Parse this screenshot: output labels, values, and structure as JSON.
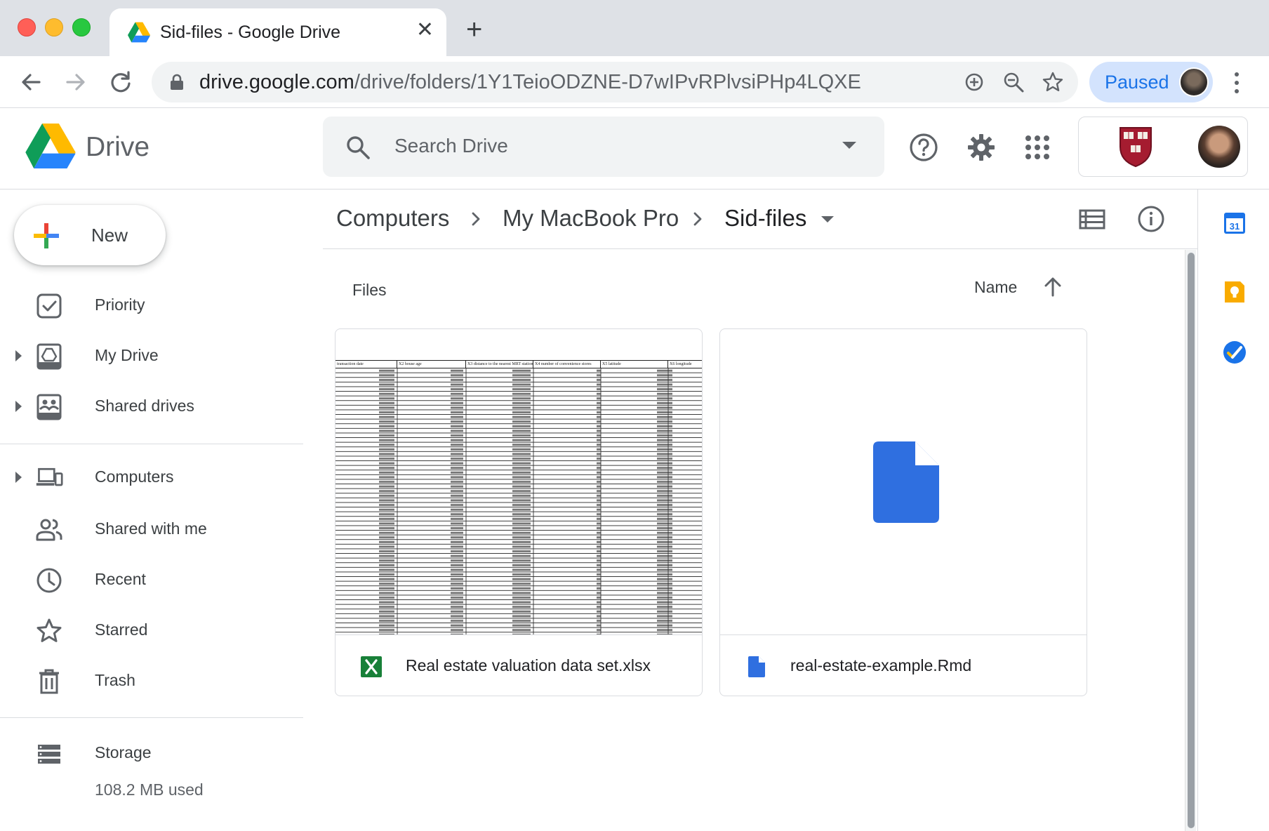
{
  "browser": {
    "tab_title": "Sid-files - Google Drive",
    "tab_close": "✕",
    "new_tab": "+",
    "url_host": "drive.google.com",
    "url_path": "/drive/folders/1Y1TeioODZNE-D7wIPvRPlvsiPHp4LQXE",
    "profile_status": "Paused"
  },
  "header": {
    "app_name": "Drive",
    "search_placeholder": "Search Drive"
  },
  "sidebar": {
    "new_label": "New",
    "items": [
      {
        "label": "Priority",
        "icon": "priority-icon"
      },
      {
        "label": "My Drive",
        "icon": "my-drive-icon"
      },
      {
        "label": "Shared drives",
        "icon": "shared-drives-icon"
      },
      {
        "label": "Computers",
        "icon": "computers-icon"
      },
      {
        "label": "Shared with me",
        "icon": "shared-with-me-icon"
      },
      {
        "label": "Recent",
        "icon": "recent-icon"
      },
      {
        "label": "Starred",
        "icon": "star-icon"
      },
      {
        "label": "Trash",
        "icon": "trash-icon"
      },
      {
        "label": "Storage",
        "icon": "storage-icon"
      }
    ],
    "storage_used": "108.2 MB used"
  },
  "main": {
    "breadcrumb": [
      "Computers",
      "My MacBook Pro",
      "Sid-files"
    ],
    "section_heading": "Files",
    "sort_label": "Name",
    "files": [
      {
        "name": "Real estate valuation data set.xlsx",
        "type": "spreadsheet",
        "icon": "excel-icon"
      },
      {
        "name": "real-estate-example.Rmd",
        "type": "document",
        "icon": "document-icon"
      }
    ],
    "sheet_preview_headers": [
      "transaction date",
      "X2 house age",
      "X3 distance to the nearest MRT station",
      "X4 number of convenience stores",
      "X5 latitude",
      "X6 longitude"
    ]
  },
  "right_panel": {
    "calendar_day": "31"
  },
  "colors": {
    "accent_blue": "#1a73e8",
    "excel_green": "#188038",
    "doc_blue": "#2f6fe0",
    "keep_yellow": "#f9ab00"
  }
}
